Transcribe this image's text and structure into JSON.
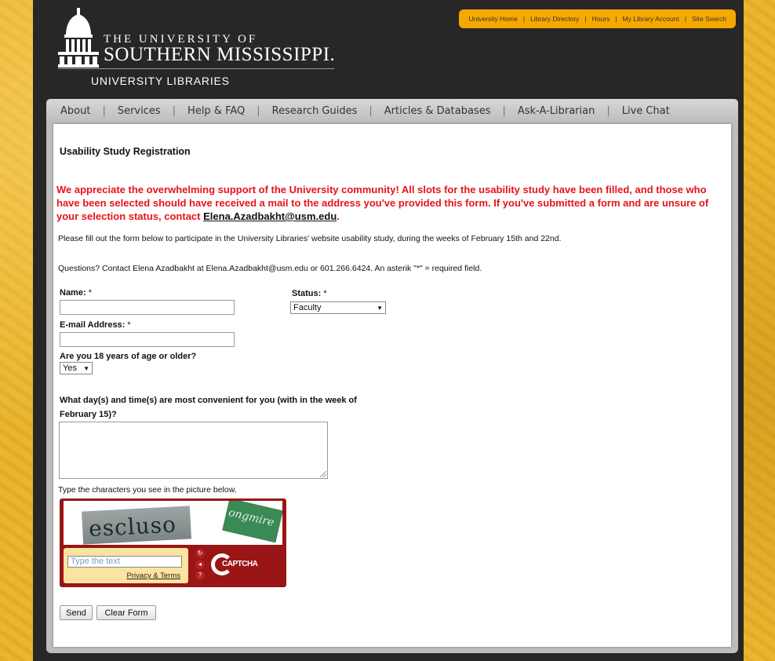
{
  "header": {
    "logo_line1": "THE UNIVERSITY OF",
    "logo_line2": "SOUTHERN MISSISSIPPI.",
    "logo_line3": "UNIVERSITY LIBRARIES",
    "utility_links": [
      "University Home",
      "Library Directory",
      "Hours",
      "My Library Account",
      "Site Search"
    ]
  },
  "nav": {
    "items": [
      "About",
      "Services",
      "Help & FAQ",
      "Research Guides",
      "Articles & Databases",
      "Ask-A-Librarian",
      "Live Chat"
    ]
  },
  "main": {
    "title": "Usability Study Registration",
    "alert_text": "We appreciate the overwhelming support of the University community! All slots for the usability study have been filled, and those who have been selected should have received a mail to the address you've provided this form. If you've submitted a form and are unsure of your selection status, contact ",
    "alert_email": "Elena.Azadbakht@usm.edu",
    "alert_end": ".",
    "intro": "Please fill out the form below to participate in the University Libraries' website usability study, during the weeks of February 15th and 22nd.",
    "questions": "Questions? Contact Elena Azadbakht at Elena.Azadbakht@usm.edu or 601.266.6424. An asterik \"*\" = required field."
  },
  "form": {
    "name_label": "Name:",
    "email_label": "E-mail Address:",
    "status_label": "Status:",
    "required_mark": "*",
    "status_value": "Faculty",
    "age_label": "Are you 18 years of age or older?",
    "age_value": "Yes",
    "times_label_line1": "What day(s) and time(s) are most convenient for you (with in the week of",
    "times_label_line2": "February 15)?",
    "captcha_note": "Type the characters you see in the picture below.",
    "captcha_word1": "escluso",
    "captcha_word2": "ongmire",
    "captcha_placeholder": "Type the text",
    "captcha_terms": "Privacy & Terms",
    "captcha_brand": "CAPTCHA",
    "send_label": "Send",
    "clear_label": "Clear Form"
  },
  "colors": {
    "alert": "#e8131b",
    "gold": "#f5a800",
    "background_dark": "#272727"
  }
}
